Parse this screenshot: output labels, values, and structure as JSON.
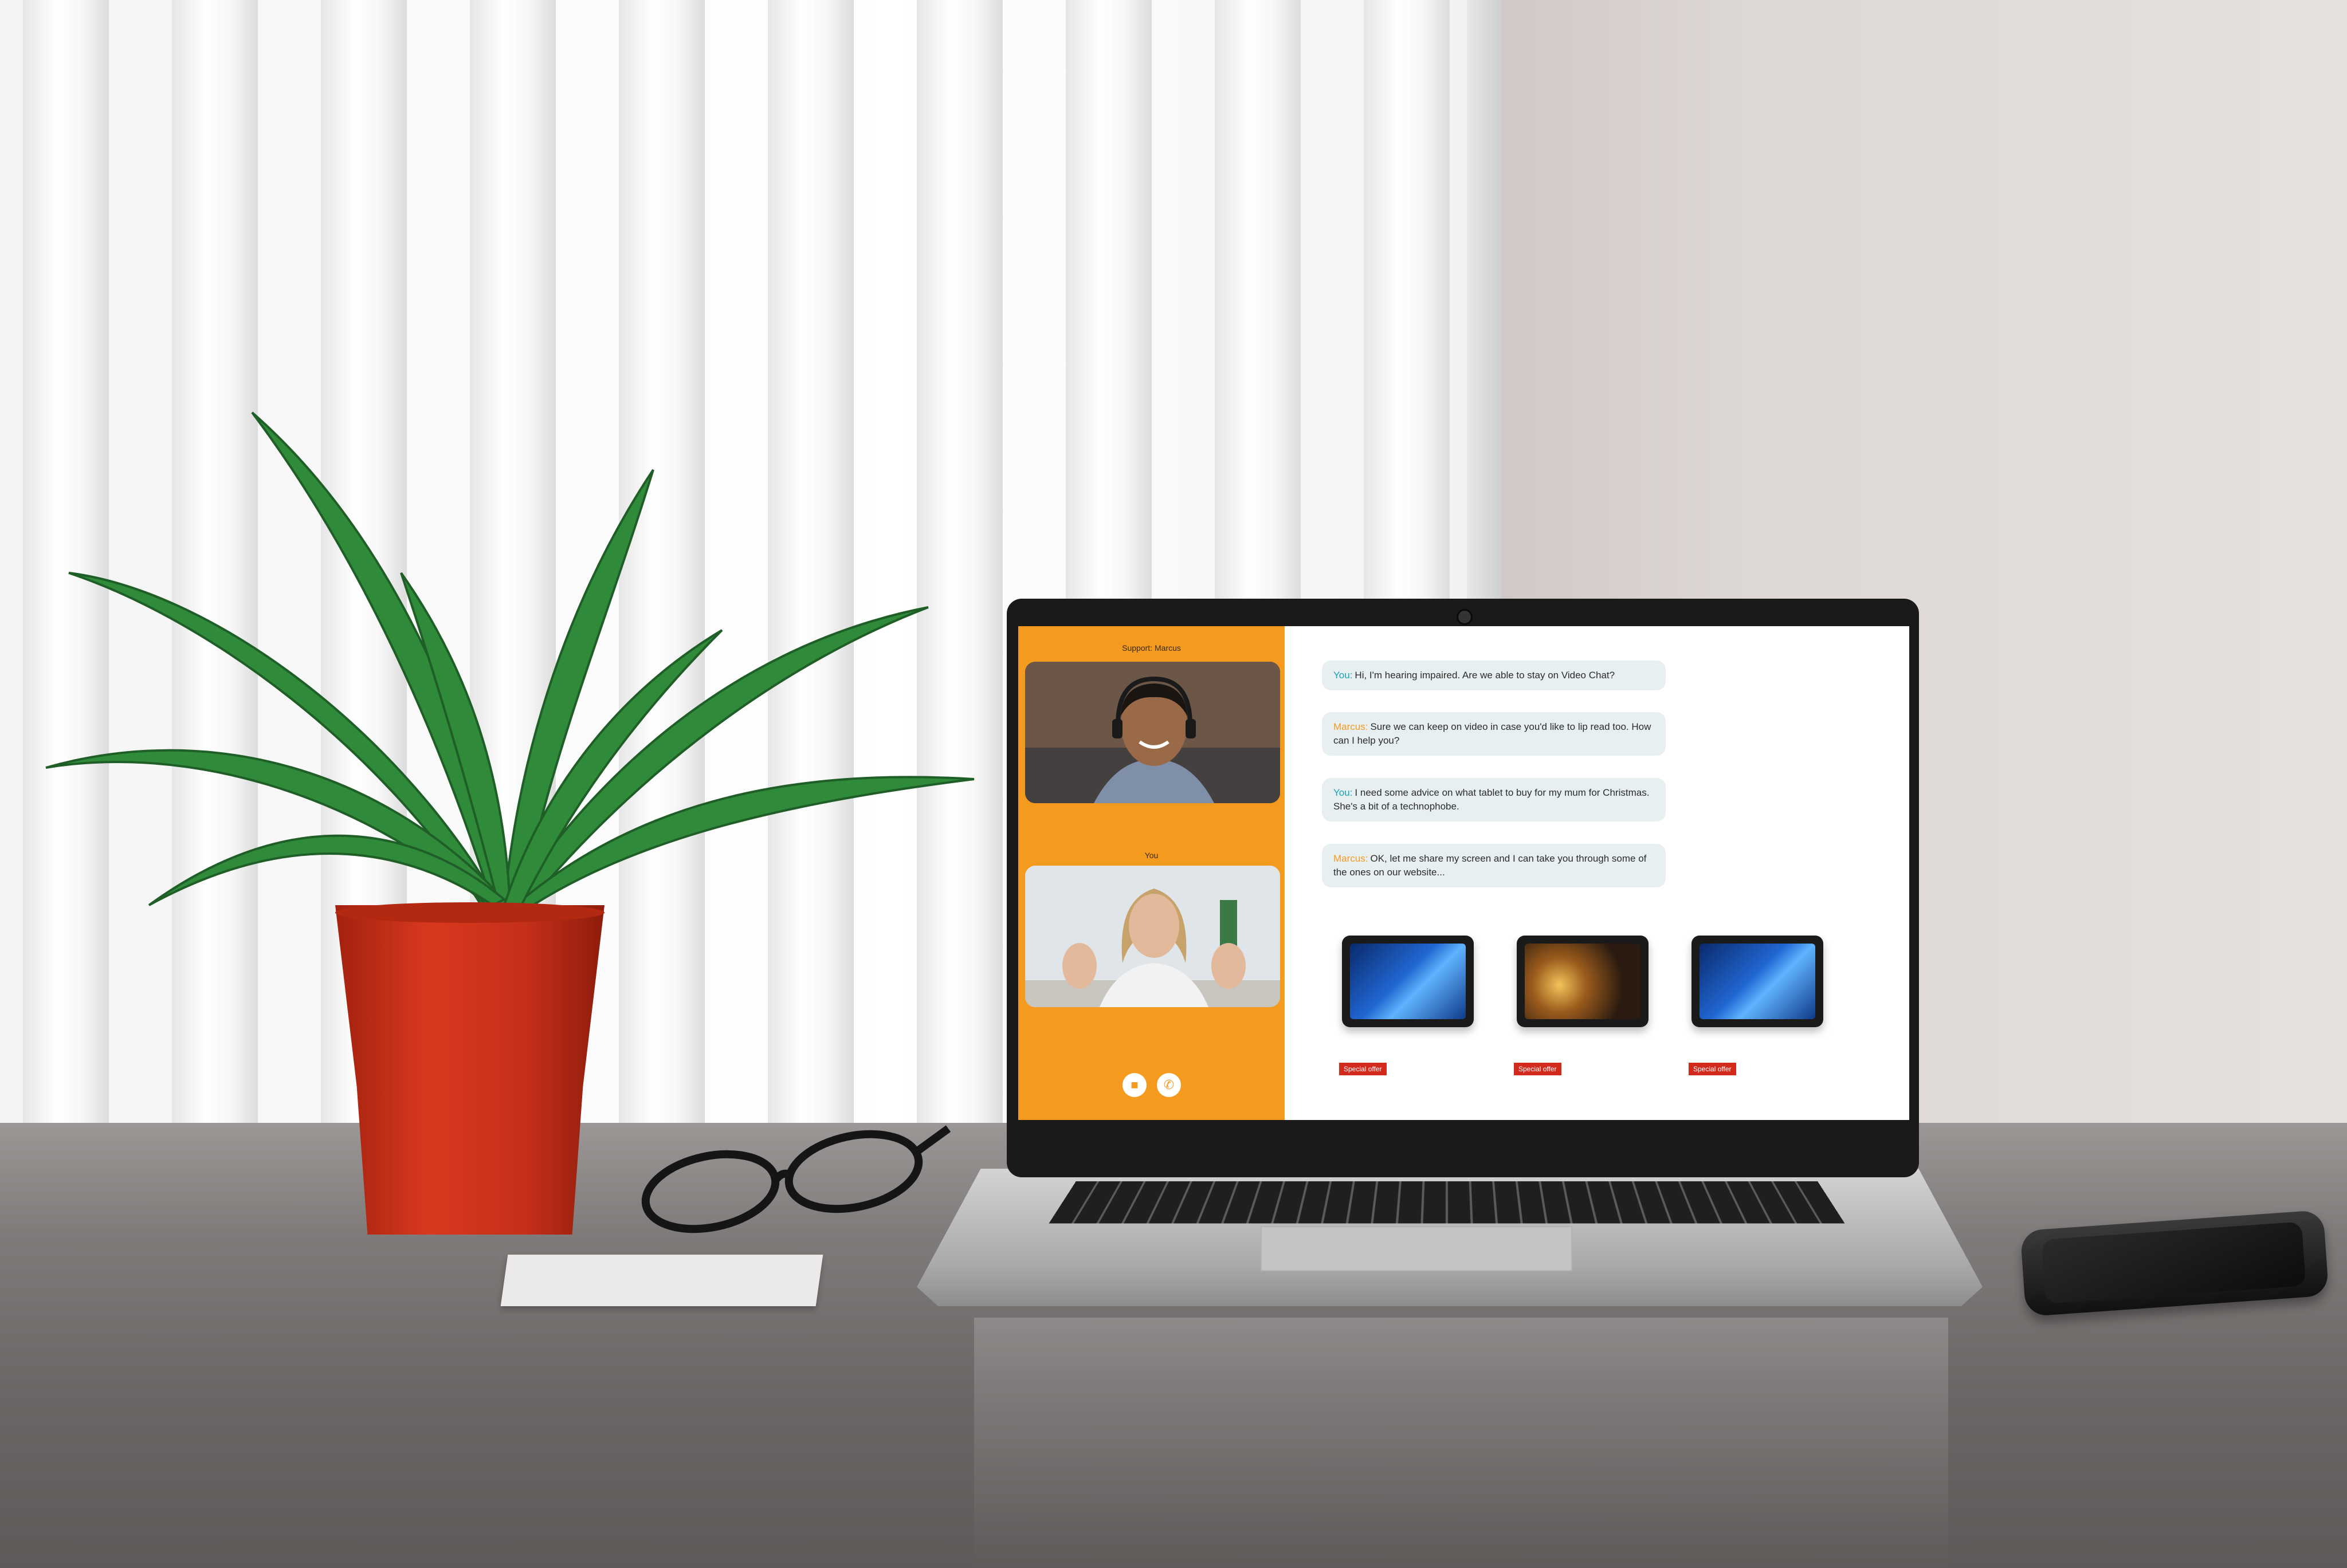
{
  "video_panel": {
    "support_label": "Support: Marcus",
    "self_label": "You",
    "controls": [
      {
        "icon": "video-camera-icon"
      },
      {
        "icon": "phone-icon"
      }
    ]
  },
  "chat": {
    "messages": [
      {
        "sender": "You:",
        "text": "Hi, I'm hearing impaired. Are we able to stay on Video Chat?"
      },
      {
        "sender": "Marcus:",
        "text": "Sure we can keep on video in case you'd like to lip read too. How can I help you?"
      },
      {
        "sender": "You:",
        "text": "I need some advice on what tablet to buy for my mum for Christmas. She's a bit of a technophobe."
      },
      {
        "sender": "Marcus:",
        "text": "OK, let me share my screen and I can take you through some of the ones on our website..."
      }
    ]
  },
  "products": [
    {
      "badge": "Special offer"
    },
    {
      "badge": "Special offer"
    },
    {
      "badge": "Special offer"
    }
  ],
  "colors": {
    "accent": "#f39a1f",
    "you_sender": "#19a3b5",
    "badge": "#d22a1c",
    "bubble": "#e7eff1"
  }
}
